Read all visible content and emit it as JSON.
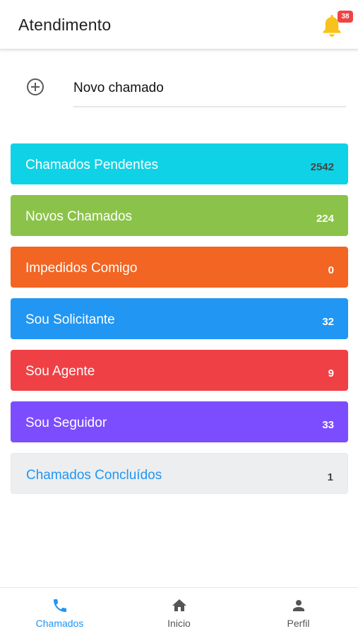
{
  "header": {
    "title": "Atendimento",
    "notification_count": "38"
  },
  "new_ticket": {
    "label": "Novo chamado",
    "icon": "plus-circle-icon"
  },
  "categories": [
    {
      "label": "Chamados Pendentes",
      "count": "2542",
      "color": "#0fd2e6"
    },
    {
      "label": "Novos Chamados",
      "count": "224",
      "color": "#8bc34a"
    },
    {
      "label": "Impedidos Comigo",
      "count": "0",
      "color": "#f26522"
    },
    {
      "label": "Sou Solicitante",
      "count": "32",
      "color": "#2196f3"
    },
    {
      "label": "Sou Agente",
      "count": "9",
      "color": "#ef4045"
    },
    {
      "label": "Sou Seguidor",
      "count": "33",
      "color": "#7c4dff"
    },
    {
      "label": "Chamados Concluídos",
      "count": "1",
      "color": "#eceef0"
    }
  ],
  "bottom_nav": [
    {
      "label": "Chamados",
      "icon": "phone-icon",
      "active": true
    },
    {
      "label": "Inicio",
      "icon": "home-icon",
      "active": false
    },
    {
      "label": "Perfil",
      "icon": "person-icon",
      "active": false
    }
  ],
  "colors": {
    "accent": "#2196f3",
    "bell": "#f8c21c",
    "badge": "#ef4444"
  }
}
